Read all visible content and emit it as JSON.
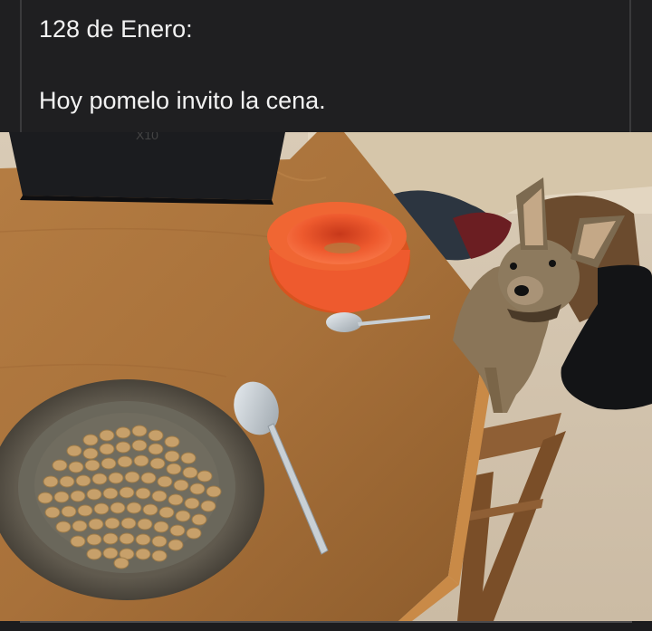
{
  "post": {
    "line1": "128 de Enero:",
    "line2": "Hoy pomelo invito la cena."
  },
  "photo": {
    "subject_icons": [
      "dog",
      "kibble-plate",
      "orange-bowl",
      "spoon",
      "laptop",
      "chair",
      "table"
    ]
  },
  "colors": {
    "background": "#1f1f21",
    "text": "#f2f2f2",
    "bowl": "#ee5a2e"
  }
}
